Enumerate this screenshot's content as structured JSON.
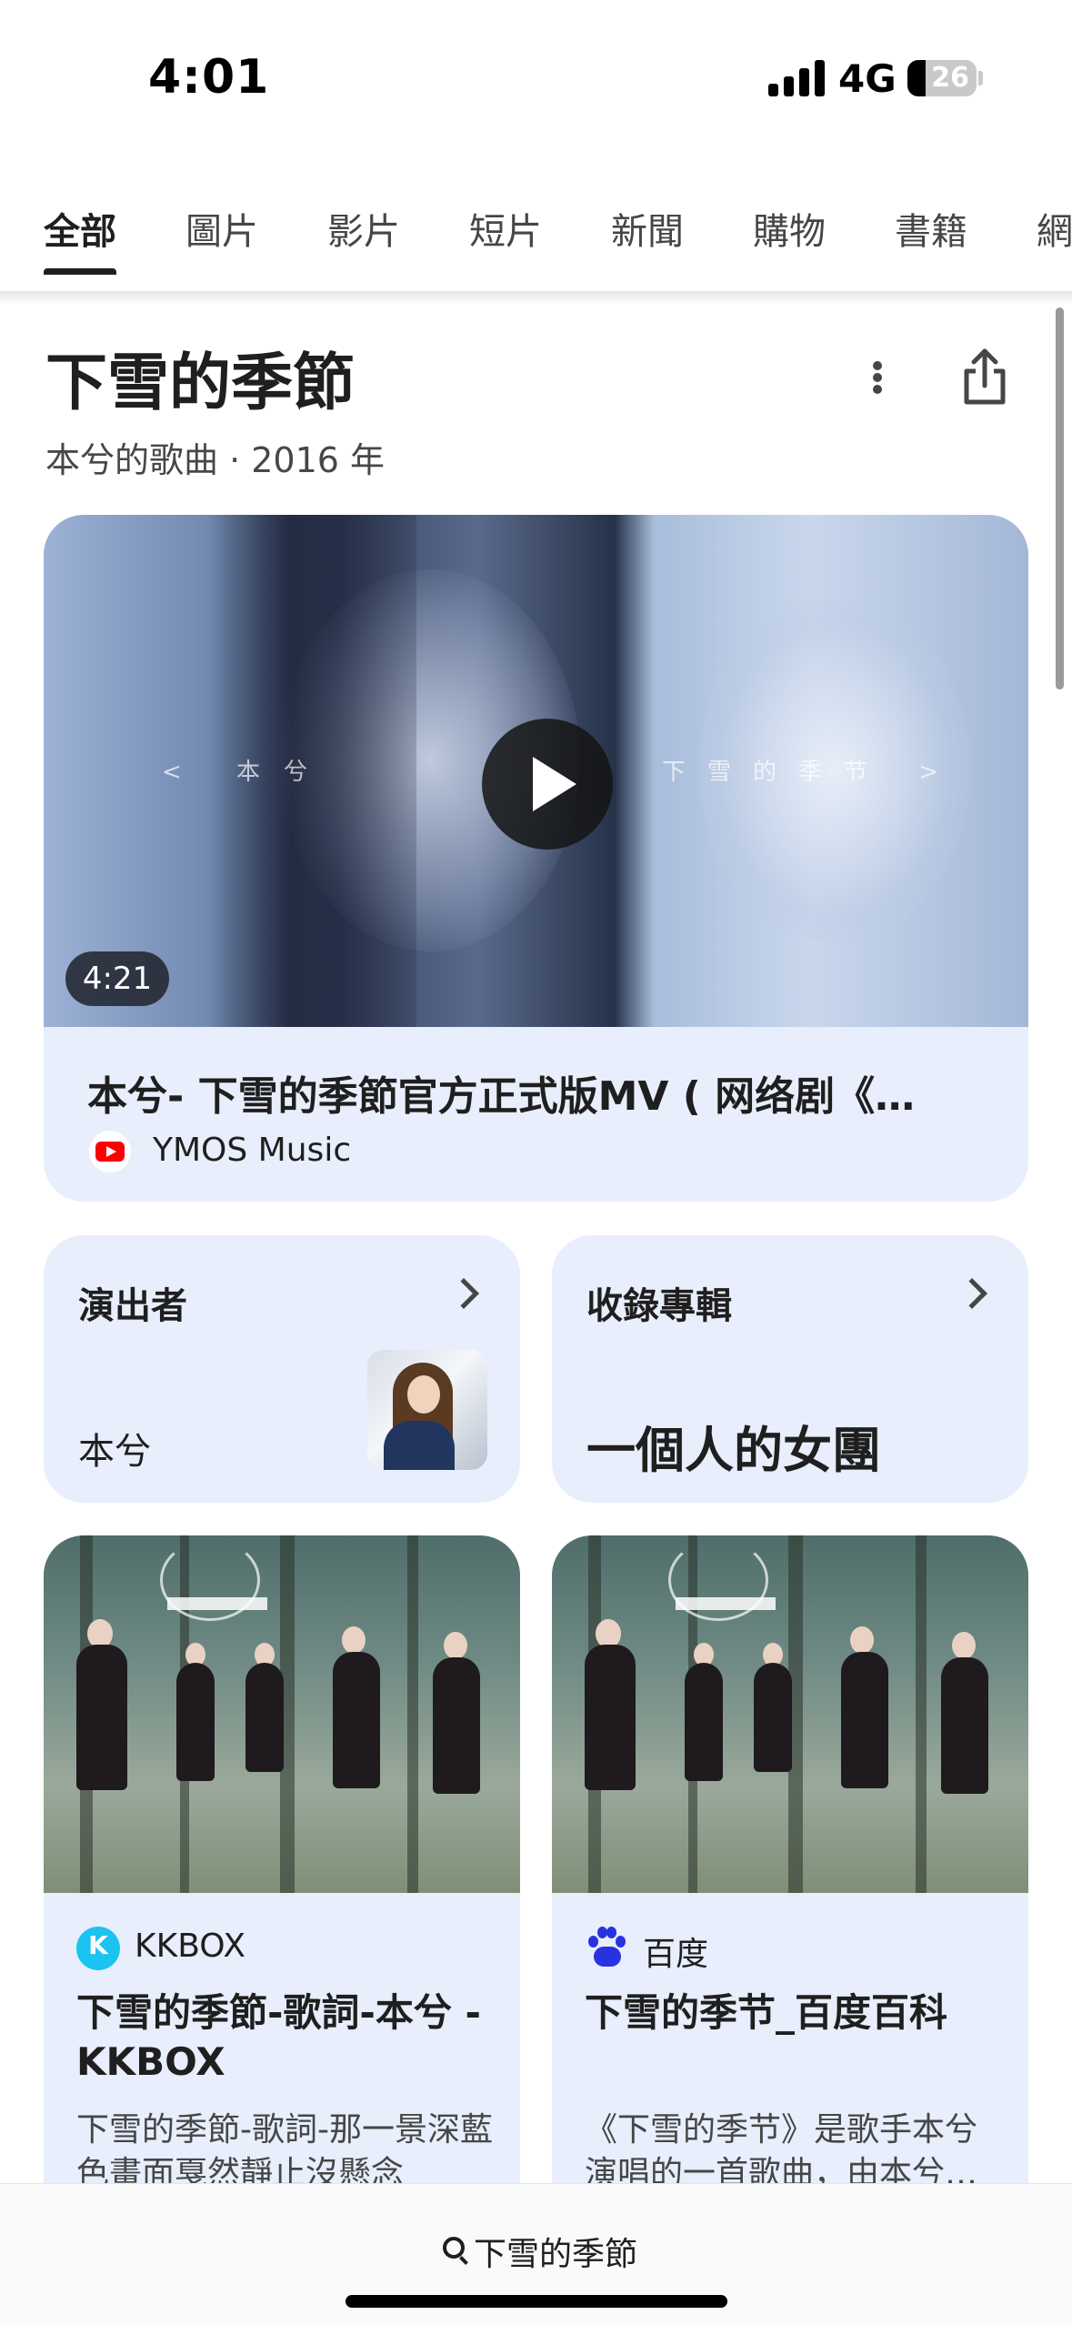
{
  "status_bar": {
    "time": "4:01",
    "network": "4G",
    "battery": 26
  },
  "tabs": [
    "全部",
    "圖片",
    "影片",
    "短片",
    "新聞",
    "購物",
    "書籍",
    "網"
  ],
  "header": {
    "title": "下雪的季節",
    "subtitle": "本兮的歌曲 · 2016 年"
  },
  "video": {
    "duration": "4:21",
    "title": "本兮- 下雪的季節官方正式版MV ( 网络剧《…",
    "source": "YMOS Music",
    "caption_left": "< 本兮",
    "caption_right": "下雪的季节 >"
  },
  "info_cards": {
    "artist_label": "演出者",
    "artist_name": "本兮",
    "album_label": "收錄專輯",
    "album_name": "一個人的女團"
  },
  "results": [
    {
      "source": "KKBOX",
      "title": "下雪的季節-歌詞-本兮 - KKBOX",
      "snippet": "下雪的季節-歌詞-那一景深藍色畫面戛然靜止沒懸念"
    },
    {
      "source": "百度",
      "title": "下雪的季节_百度百科",
      "snippet": "《下雪的季节》是歌手本兮演唱的一首歌曲，由本兮…"
    }
  ],
  "search": {
    "query": "下雪的季節"
  },
  "colors": {
    "card_bg": "#e8eefc",
    "youtube_red": "#ff0000",
    "kkbox_blue": "#1ac3f0",
    "baidu_blue": "#2932e1"
  }
}
